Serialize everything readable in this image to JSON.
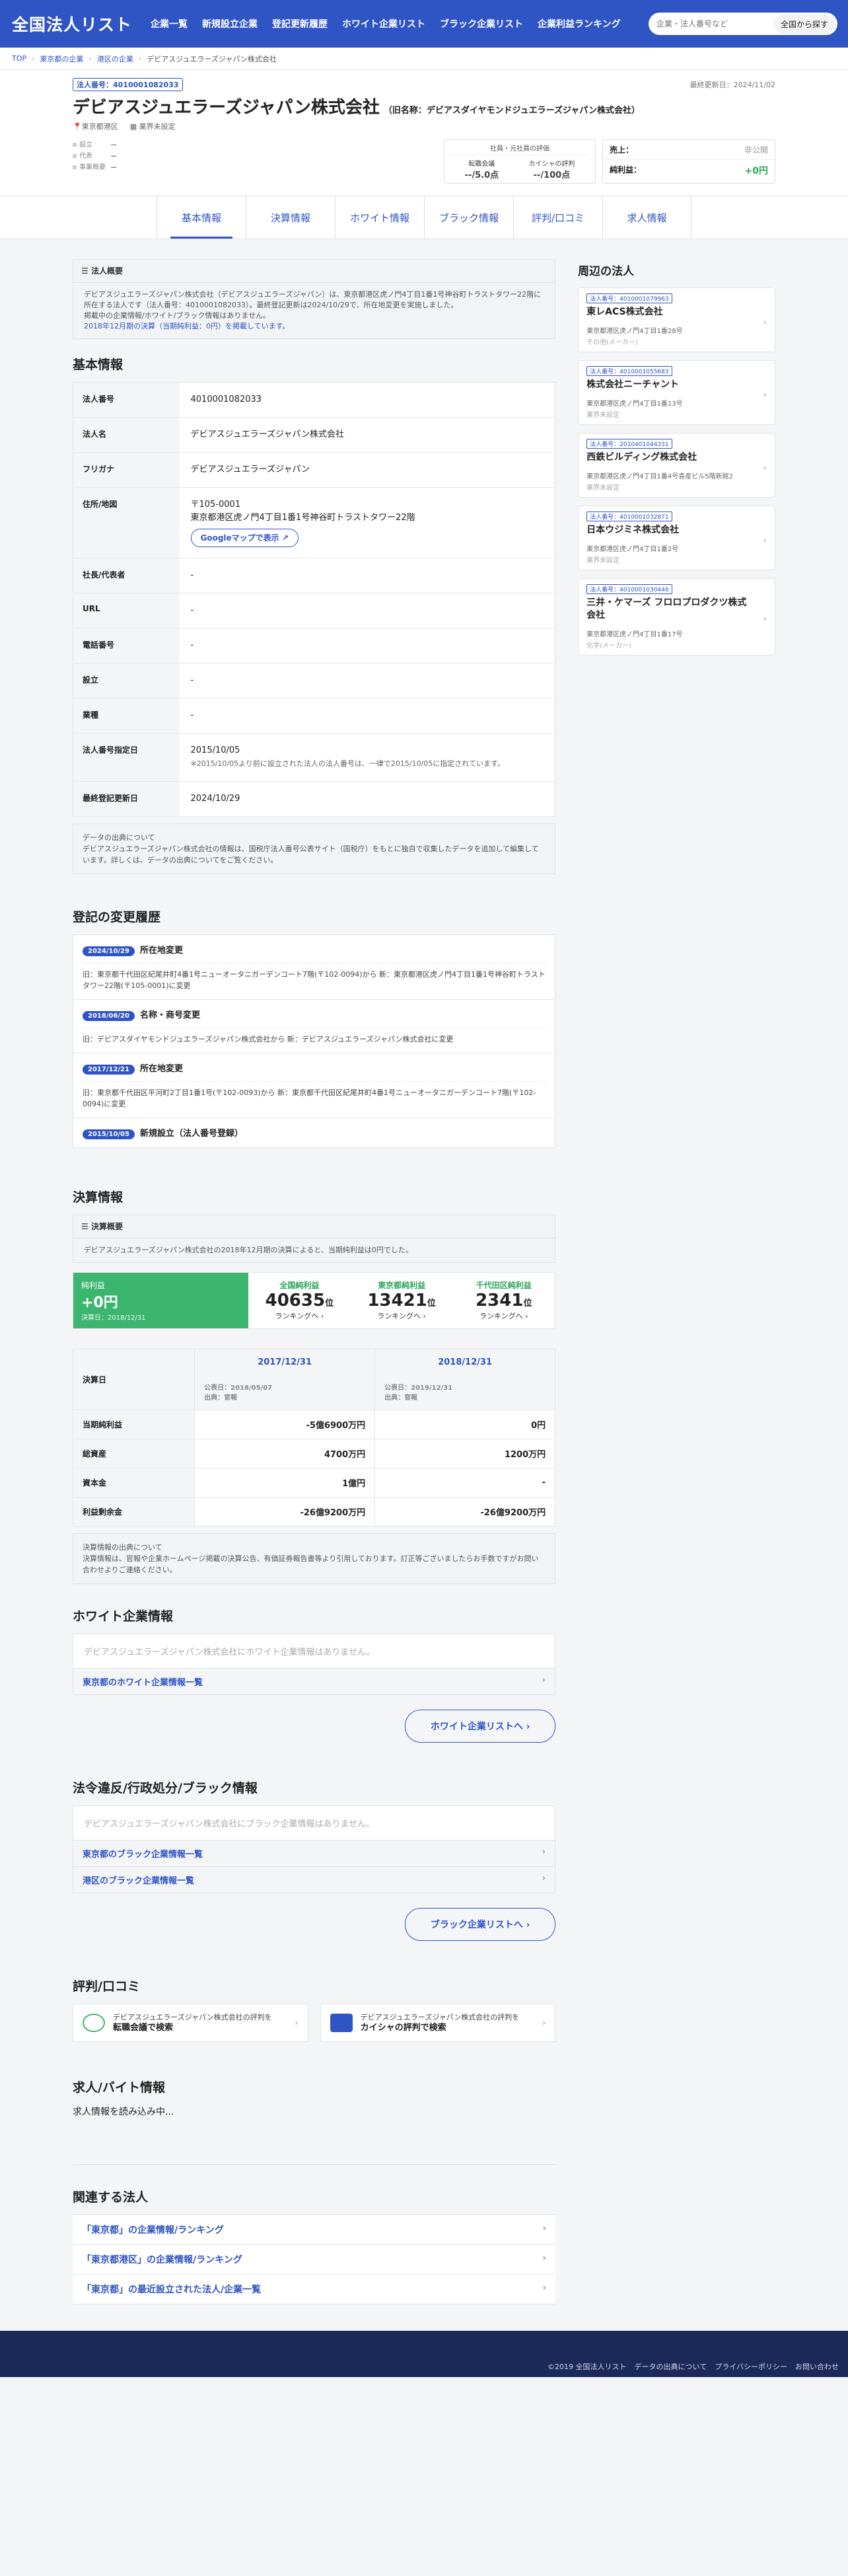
{
  "header": {
    "logo": "全国法人リスト",
    "nav": [
      "企業一覧",
      "新規設立企業",
      "登記更新履歴",
      "ホワイト企業リスト",
      "ブラック企業リスト",
      "企業利益ランキング"
    ],
    "search_placeholder": "企業・法人番号など",
    "search_button": "全国から探す"
  },
  "breadcrumb": [
    "TOP",
    "東京都の企業",
    "港区の企業",
    "デビアスジュエラーズジャパン株式会社"
  ],
  "company": {
    "corp_number": "法人番号：4010001082033",
    "updated": "最終更新日：2024/11/02",
    "name": "デビアスジュエラーズジャパン株式会社",
    "former": "（旧名称：デビアスダイヤモンドジュエラーズジャパン株式会社）",
    "location": "東京都港区",
    "industry": "業界未設定",
    "info": [
      {
        "k": "設立",
        "v": "--"
      },
      {
        "k": "代表",
        "v": "--"
      },
      {
        "k": "事業概要",
        "v": "--"
      }
    ],
    "review_title": "社員・元社員の評価",
    "review_a_label": "転職会議",
    "review_a": "--/5.0点",
    "review_b_label": "カイシャの評判",
    "review_b": "--/100点",
    "sales_label": "売上：",
    "sales_value": "非公開",
    "profit_label": "純利益：",
    "profit_value": "+0円"
  },
  "tabs": [
    "基本情報",
    "決算情報",
    "ホワイト情報",
    "ブラック情報",
    "評判/口コミ",
    "求人情報"
  ],
  "overview": {
    "title": "法人概要",
    "text": "デビアスジュエラーズジャパン株式会社（デビアスジュエラーズジャパン）は、東京都港区虎ノ門4丁目1番1号神谷町トラストタワー22階に所在する法人です（法人番号：4010001082033）。最終登記更新は2024/10/29で、所在地変更を実施しました。",
    "text2": "掲載中の企業情報/ホワイト/ブラック情報はありません。",
    "text3": "2018年12月期の決算（当期純利益：0円）を掲載しています。"
  },
  "basic": {
    "heading": "基本情報",
    "rows": [
      {
        "k": "法人番号",
        "v": "4010001082033"
      },
      {
        "k": "法人名",
        "v": "デビアスジュエラーズジャパン株式会社"
      },
      {
        "k": "フリガナ",
        "v": "デビアスジュエラーズジャパン"
      },
      {
        "k": "社長/代表者",
        "v": "-"
      },
      {
        "k": "URL",
        "v": "-"
      },
      {
        "k": "電話番号",
        "v": "-"
      },
      {
        "k": "設立",
        "v": "-"
      },
      {
        "k": "業種",
        "v": "-"
      },
      {
        "k": "最終登記更新日",
        "v": "2024/10/29"
      }
    ],
    "addr_label": "住所/地図",
    "addr_zip": "〒105-0001",
    "addr": "東京都港区虎ノ門4丁目1番1号神谷町トラストタワー22階",
    "map_btn": "Googleマップで表示 ↗",
    "reg_label": "法人番号指定日",
    "reg_date": "2015/10/05",
    "reg_note": "※2015/10/05より前に設立された法人の法人番号は、一律で2015/10/05に指定されています。"
  },
  "source": {
    "title": "データの出典について",
    "text": "デビアスジュエラーズジャパン株式会社の情報は、国税庁法人番号公表サイト（国税庁）をもとに独自で収集したデータを追加して編集しています。詳しくは、データの出典についてをご覧ください。"
  },
  "history": {
    "heading": "登記の変更履歴",
    "items": [
      {
        "date": "2024/10/29",
        "type": "所在地変更",
        "desc": "旧：東京都千代田区紀尾井町4番1号ニューオータニガーデンコート7階(〒102-0094)から 新：東京都港区虎ノ門4丁目1番1号神谷町トラストタワー22階(〒105-0001)に変更"
      },
      {
        "date": "2018/06/20",
        "type": "名称・商号変更",
        "desc": "旧：デビアスダイヤモンドジュエラーズジャパン株式会社から 新：デビアスジュエラーズジャパン株式会社に変更"
      },
      {
        "date": "2017/12/21",
        "type": "所在地変更",
        "desc": "旧：東京都千代田区平河町2丁目1番1号(〒102-0093)から 新：東京都千代田区紀尾井町4番1号ニューオータニガーデンコート7階(〒102-0094)に変更"
      },
      {
        "date": "2015/10/05",
        "type": "新規設立（法人番号登録）",
        "desc": ""
      }
    ]
  },
  "finance": {
    "heading": "決算情報",
    "summary_title": "決算概要",
    "summary_text": "デビアスジュエラーズジャパン株式会社の2018年12月期の決算によると、当期純利益は0円でした。",
    "net_label": "純利益",
    "net_value": "+0円",
    "net_date": "決算日：2018/12/31",
    "ranks": [
      {
        "label": "全国純利益",
        "n": "40635",
        "unit": "位",
        "link": "ランキングへ ›"
      },
      {
        "label": "東京都純利益",
        "n": "13421",
        "unit": "位",
        "link": "ランキングへ ›"
      },
      {
        "label": "千代田区純利益",
        "n": "2341",
        "unit": "位",
        "link": "ランキングへ ›"
      }
    ],
    "date_label": "決算日",
    "years": [
      {
        "y": "2017/12/31",
        "pub": "公表日：2018/05/07",
        "src": "出典：官報"
      },
      {
        "y": "2018/12/31",
        "pub": "公表日：2019/12/31",
        "src": "出典：官報"
      }
    ],
    "rows": [
      {
        "k": "当期純利益",
        "a": "-5億6900万円",
        "b": "0円"
      },
      {
        "k": "総資産",
        "a": "4700万円",
        "b": "1200万円"
      },
      {
        "k": "資本金",
        "a": "1億円",
        "b": "-"
      },
      {
        "k": "利益剰余金",
        "a": "-26億9200万円",
        "b": "-26億9200万円"
      }
    ],
    "src_title": "決算情報の出典について",
    "src_text": "決算情報は、官報や企業ホームページ掲載の決算公告、有価証券報告書等より引用しております。訂正等ございましたらお手数ですがお問い合わせよりご連絡ください。"
  },
  "white": {
    "heading": "ホワイト企業情報",
    "none": "デビアスジュエラーズジャパン株式会社にホワイト企業情報はありません。",
    "link": "東京都のホワイト企業情報一覧",
    "btn": "ホワイト企業リストへ ›"
  },
  "black": {
    "heading": "法令違反/行政処分/ブラック情報",
    "none": "デビアスジュエラーズジャパン株式会社にブラック企業情報はありません。",
    "links": [
      "東京都のブラック企業情報一覧",
      "港区のブラック企業情報一覧"
    ],
    "btn": "ブラック企業リストへ ›"
  },
  "review": {
    "heading": "評判/口コミ",
    "cards": [
      {
        "pre": "デビアスジュエラーズジャパン株式会社の評判を",
        "main": "転職会議で検索"
      },
      {
        "pre": "デビアスジュエラーズジャパン株式会社の評判を",
        "main": "カイシャの評判で検索"
      }
    ]
  },
  "jobs": {
    "heading": "求人/バイト情報",
    "loading": "求人情報を読み込み中..."
  },
  "related": {
    "heading": "関連する法人",
    "links": [
      "「東京都」の企業情報/ランキング",
      "「東京都港区」の企業情報/ランキング",
      "「東京都」の最近設立された法人/企業一覧"
    ]
  },
  "nearby": {
    "heading": "周辺の法人",
    "items": [
      {
        "num": "法人番号：4010001079963",
        "name": "東レACS株式会社",
        "addr": "東京都港区虎ノ門4丁目1番28号",
        "ind": "その他(メーカー)"
      },
      {
        "num": "法人番号：4010001055683",
        "name": "株式会社ニーチャント",
        "addr": "東京都港区虎ノ門4丁目1番13号",
        "ind": "業界未設定"
      },
      {
        "num": "法人番号：2010401044331",
        "name": "西鉄ビルディング株式会社",
        "addr": "東京都港区虎ノ門4丁目1番4号喜産ビル5階新館2",
        "ind": "業界未設定"
      },
      {
        "num": "法人番号：4010001032871",
        "name": "日本ウジミネ株式会社",
        "addr": "東京都港区虎ノ門4丁目1番2号",
        "ind": "業界未設定"
      },
      {
        "num": "法人番号：4010001030446",
        "name": "三井・ケマーズ フロロプロダクツ株式会社",
        "addr": "東京都港区虎ノ門4丁目1番17号",
        "ind": "化学(メーカー)"
      }
    ]
  },
  "footer": [
    "©2019 全国法人リスト",
    "データの出典について",
    "プライバシーポリシー",
    "お問い合わせ"
  ]
}
